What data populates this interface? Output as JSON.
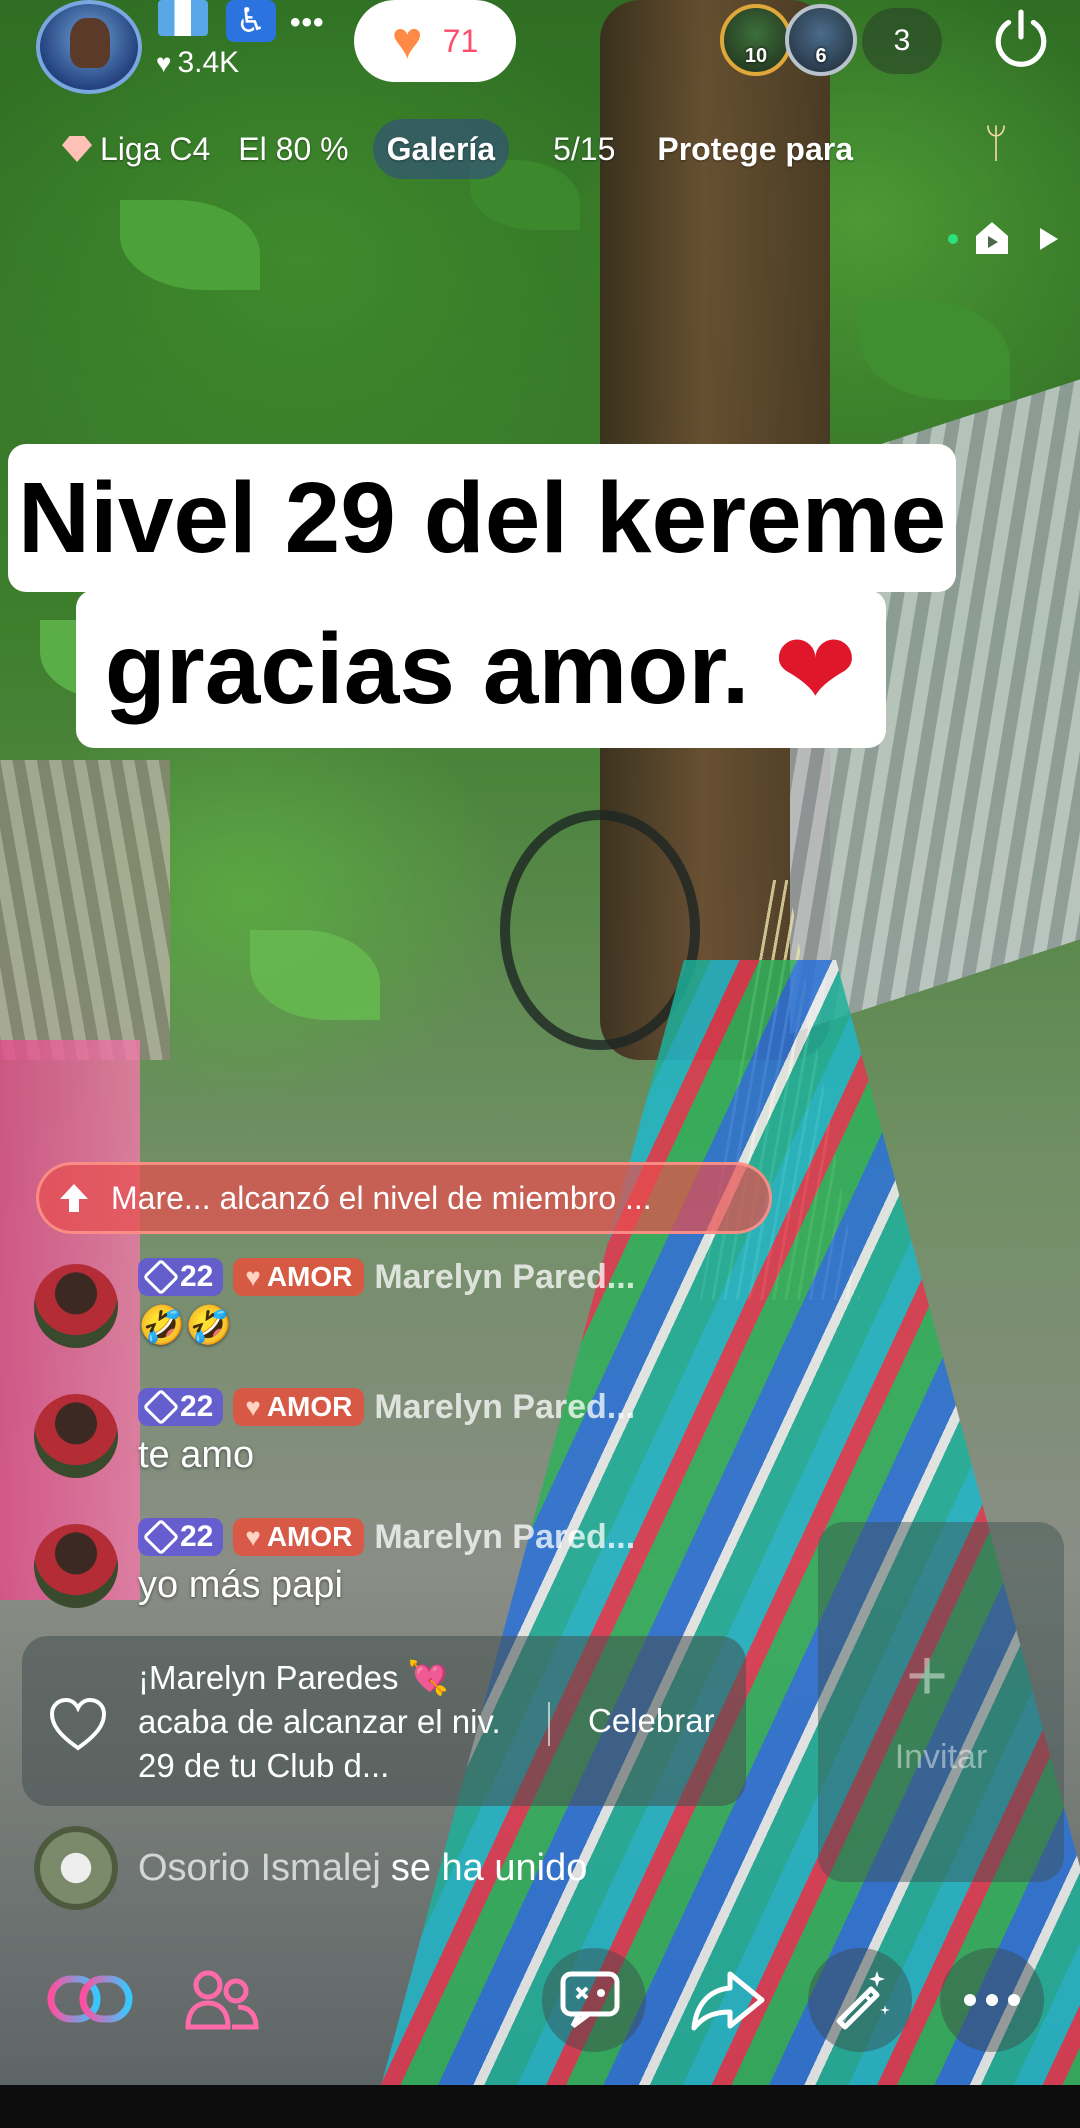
{
  "host": {
    "likes": "3.4K",
    "avatar_icon": "host-avatar"
  },
  "top": {
    "more_label": "•••",
    "like_pill_count": "71",
    "viewers": [
      {
        "rank": "10",
        "ring_color": "#e0a83a"
      },
      {
        "rank": "6",
        "ring_color": "#b8c3cc"
      }
    ],
    "viewer_count": "3",
    "power_icon": "power-icon"
  },
  "chips": {
    "league": "Liga C4",
    "percent": "El 80 %",
    "gallery": "Galería",
    "pager": "5/15",
    "protect": "Protege para"
  },
  "caption": {
    "line1": "Nivel 29 del kereme",
    "line2": "gracias amor.",
    "emoji": "❤"
  },
  "banner": {
    "text": "Mare... alcanzó el nivel de miembro ..."
  },
  "messages": [
    {
      "level": "22",
      "badge": "AMOR",
      "user": "Marelyn Pared...",
      "text": "🤣🤣"
    },
    {
      "level": "22",
      "badge": "AMOR",
      "user": "Marelyn Pared...",
      "text": "te amo"
    },
    {
      "level": "22",
      "badge": "AMOR",
      "user": "Marelyn Pared...",
      "text": "yo más papi"
    }
  ],
  "club_card": {
    "text": "¡Marelyn Paredes 💘 acaba de alcanzar el niv. 29 de tu Club d...",
    "action": "Celebrar"
  },
  "invite": {
    "plus": "+",
    "label": "Invitar"
  },
  "joined": {
    "user": "Osorio Ismalej",
    "text": "se ha unido"
  },
  "toolbar": {
    "icons": [
      "link-icon",
      "users-icon",
      "chat-icon",
      "share-icon",
      "magic-wand-icon",
      "more-icon"
    ]
  },
  "colors": {
    "banner": "#e84e4e",
    "level_badge": "#6056dc",
    "amor_badge": "#e6503c",
    "like_count": "#ff4d6d"
  }
}
